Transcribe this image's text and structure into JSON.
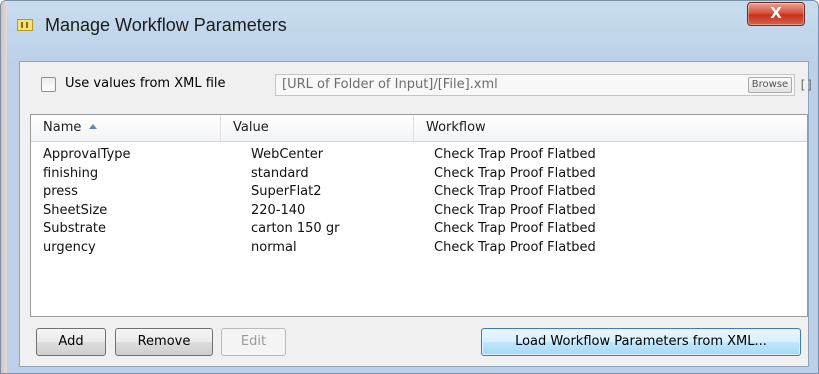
{
  "window": {
    "title": "Manage Workflow Parameters",
    "close_label": "X"
  },
  "xml_source": {
    "checkbox_label": "Use values from XML file",
    "checked": false,
    "path_value": "[URL of Folder of Input]/[File].xml",
    "browse_label": "Browse",
    "bracket_label": "[]"
  },
  "table": {
    "columns": [
      {
        "label": "Name",
        "sorted": "ascending"
      },
      {
        "label": "Value"
      },
      {
        "label": "Workflow"
      }
    ],
    "rows": [
      {
        "name": "ApprovalType",
        "value": "WebCenter",
        "workflow": "Check Trap Proof Flatbed"
      },
      {
        "name": "finishing",
        "value": "standard",
        "workflow": "Check Trap Proof Flatbed"
      },
      {
        "name": "press",
        "value": "SuperFlat2",
        "workflow": "Check Trap Proof Flatbed"
      },
      {
        "name": "SheetSize",
        "value": "220-140",
        "workflow": "Check Trap Proof Flatbed"
      },
      {
        "name": "Substrate",
        "value": "carton 150 gr",
        "workflow": "Check Trap Proof Flatbed"
      },
      {
        "name": "urgency",
        "value": "normal",
        "workflow": "Check Trap Proof Flatbed"
      }
    ]
  },
  "buttons": {
    "add": "Add",
    "remove": "Remove",
    "edit": "Edit",
    "load": "Load Workflow Parameters from XML..."
  },
  "colors": {
    "close_button": "#c4321b",
    "default_button_border": "#3c7fb1",
    "sort_arrow": "#5f88b3"
  }
}
